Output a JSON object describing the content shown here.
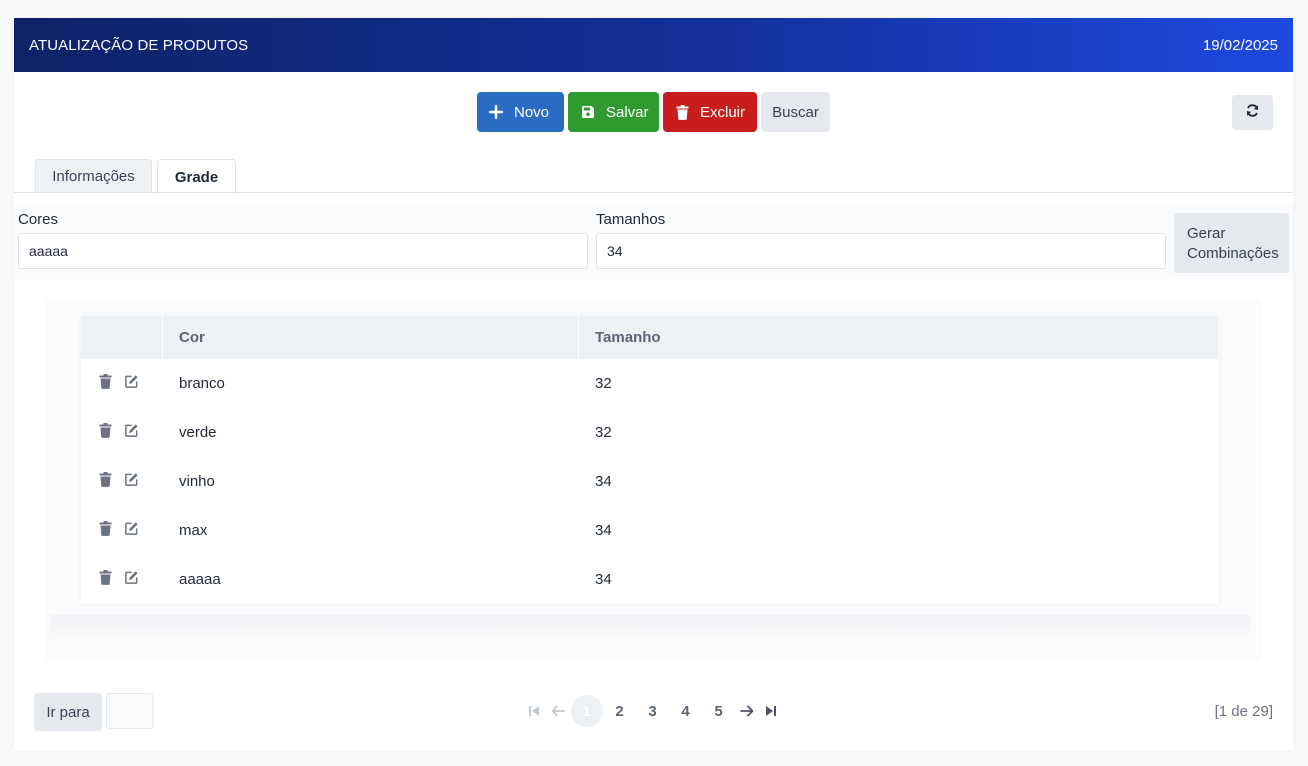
{
  "header": {
    "title": "ATUALIZAÇÃO DE PRODUTOS",
    "date": "19/02/2025"
  },
  "toolbar": {
    "novo": "Novo",
    "salvar": "Salvar",
    "excluir": "Excluir",
    "buscar": "Buscar"
  },
  "tabs": [
    {
      "label": "Informações",
      "active": false
    },
    {
      "label": "Grade",
      "active": true
    }
  ],
  "form": {
    "cores_label": "Cores",
    "cores_value": "aaaaa",
    "tamanhos_label": "Tamanhos",
    "tamanhos_value": "34",
    "gerar_label_line1": "Gerar",
    "gerar_label_line2": "Combinações"
  },
  "table": {
    "columns": [
      "",
      "Cor",
      "Tamanho"
    ],
    "rows": [
      {
        "cor": "branco",
        "tamanho": "32"
      },
      {
        "cor": "verde",
        "tamanho": "32"
      },
      {
        "cor": "vinho",
        "tamanho": "34"
      },
      {
        "cor": "max",
        "tamanho": "34"
      },
      {
        "cor": "aaaaa",
        "tamanho": "34"
      }
    ],
    "row_icons": [
      "trash-icon",
      "edit-icon"
    ]
  },
  "pagination": {
    "goto_label": "Ir para",
    "pages": [
      "1",
      "2",
      "3",
      "4",
      "5"
    ],
    "current_page": "1",
    "info": "[1 de 29]"
  },
  "colors": {
    "novo": "#2a6bc4",
    "salvar": "#2f9a2f",
    "excluir": "#c91d1d",
    "header_start": "#0e2266",
    "header_end": "#1d49df"
  }
}
